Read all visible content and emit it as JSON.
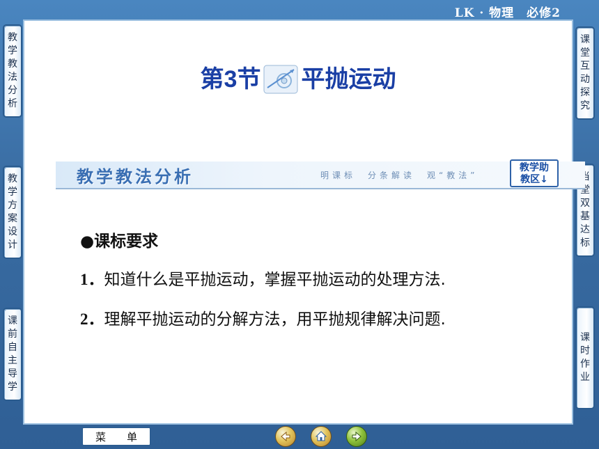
{
  "header": {
    "brand": "LK · 物理　必修2"
  },
  "left_tabs": [
    {
      "label": [
        "教",
        "学",
        "教",
        "法",
        "分",
        "析"
      ]
    },
    {
      "label": [
        "教",
        "学",
        "方",
        "案",
        "设",
        "计"
      ]
    },
    {
      "label": [
        "课",
        "前",
        "自",
        "主",
        "导",
        "学"
      ]
    }
  ],
  "right_tabs": [
    {
      "label": [
        "课",
        "堂",
        "互",
        "动",
        "探",
        "究"
      ]
    },
    {
      "label": [
        "当",
        "堂",
        "双",
        "基",
        "达",
        "标"
      ]
    },
    {
      "label": [
        "课",
        "时",
        "作",
        "业"
      ]
    }
  ],
  "title": {
    "prefix": "第",
    "number": "3",
    "section": "节",
    "name": "平抛运动"
  },
  "banner": {
    "title": "教学教法分析",
    "subtitle": "明课标　分条解读　观“教法”"
  },
  "help_button": {
    "line1": "教学助",
    "line2": "教区↓"
  },
  "content": {
    "section_heading": "●课标要求",
    "items": [
      {
        "num": "1．",
        "text": "知道什么是平抛运动，掌握平抛运动的处理方法."
      },
      {
        "num": "2．",
        "text": "理解平抛运动的分解方法，用平抛规律解决问题."
      }
    ]
  },
  "bottom": {
    "menu_left": "菜",
    "menu_right": "单",
    "buttons": [
      "previous-icon",
      "home-icon",
      "next-icon"
    ]
  }
}
